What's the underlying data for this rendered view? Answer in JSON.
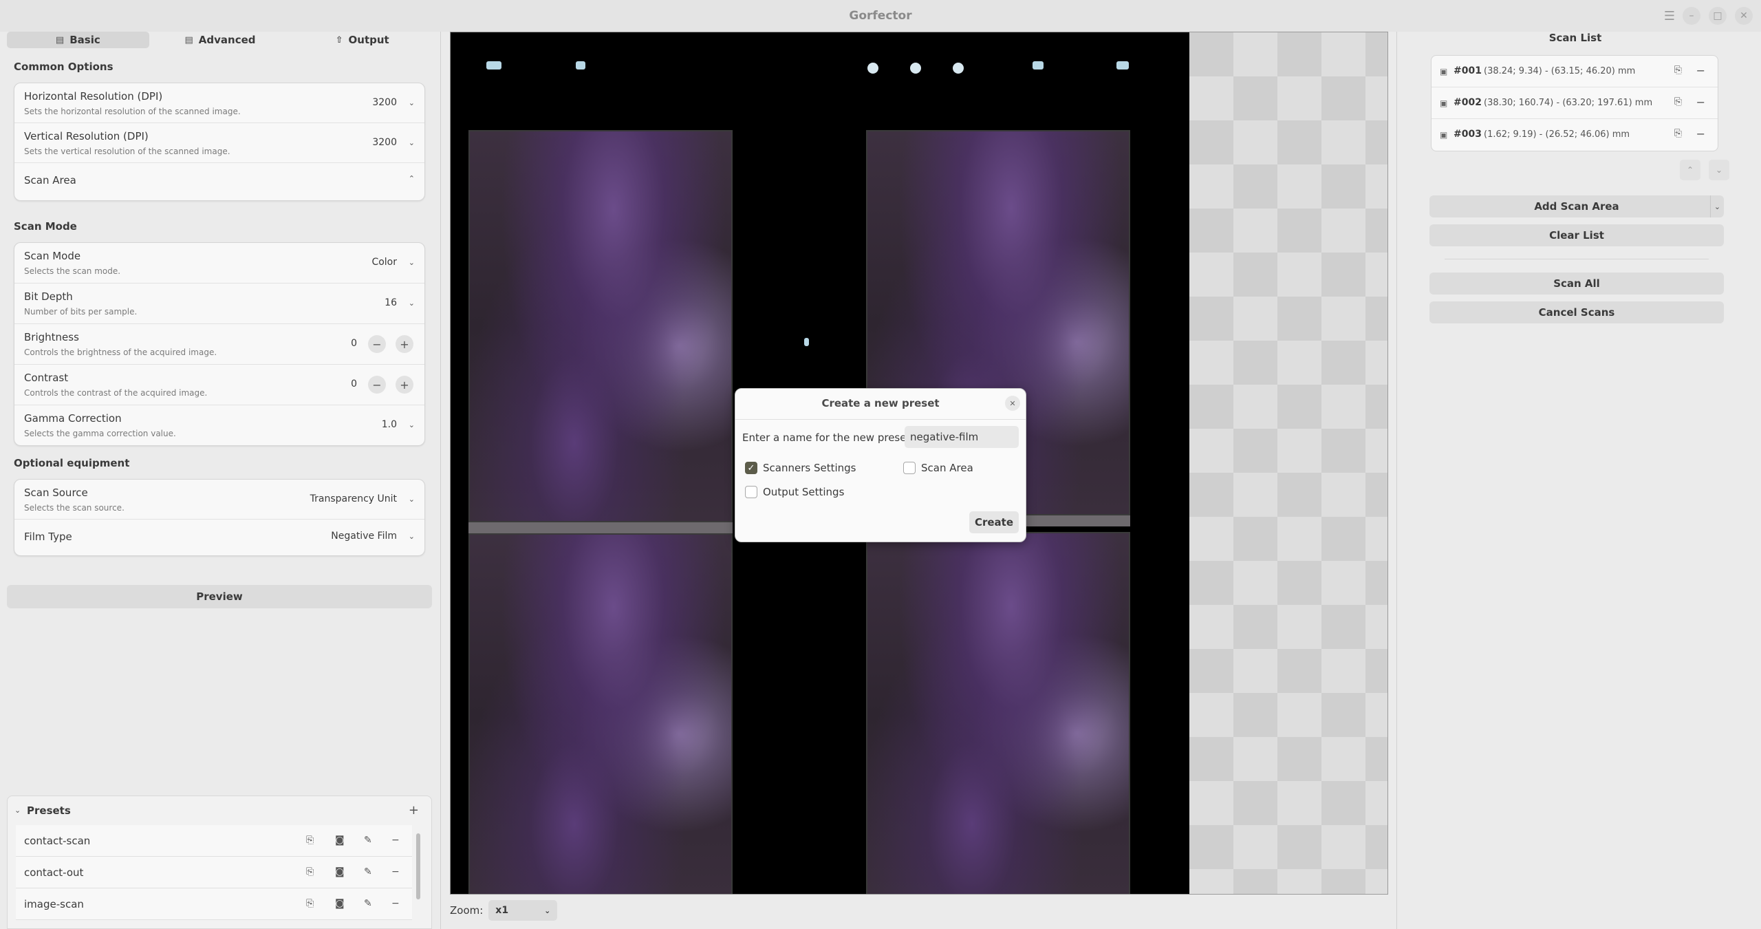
{
  "window": {
    "title": "Gorfector",
    "controls": [
      "menu-icon",
      "minimize-icon",
      "maximize-icon",
      "close-icon"
    ]
  },
  "tabs": [
    {
      "label": "Basic",
      "icon": "document-icon",
      "active": true
    },
    {
      "label": "Advanced",
      "icon": "document-icon",
      "active": false
    },
    {
      "label": "Output",
      "icon": "upload-icon",
      "active": false
    }
  ],
  "common_options": {
    "title": "Common Options",
    "rows": [
      {
        "label": "Horizontal Resolution (DPI)",
        "subtitle": "Sets the horizontal resolution of the scanned image.",
        "value": "3200"
      },
      {
        "label": "Vertical Resolution (DPI)",
        "subtitle": "Sets the vertical resolution of the scanned image.",
        "value": "3200"
      },
      {
        "label": "Scan Area"
      }
    ]
  },
  "scan_mode": {
    "title": "Scan Mode",
    "rows": [
      {
        "label": "Scan Mode",
        "subtitle": "Selects the scan mode.",
        "value": "Color"
      },
      {
        "label": "Bit Depth",
        "subtitle": "Number of bits per sample.",
        "value": "16"
      },
      {
        "label": "Brightness",
        "subtitle": "Controls the brightness of the acquired image.",
        "value": "0"
      },
      {
        "label": "Contrast",
        "subtitle": "Controls the contrast of the acquired image.",
        "value": "0"
      },
      {
        "label": "Gamma Correction",
        "subtitle": "Selects the gamma correction value.",
        "value": "1.0"
      }
    ]
  },
  "optional_equipment": {
    "title": "Optional equipment",
    "rows": [
      {
        "label": "Scan Source",
        "subtitle": "Selects the scan source.",
        "value": "Transparency Unit"
      },
      {
        "label": "Film Type",
        "value": "Negative Film"
      }
    ]
  },
  "preview_button": "Preview",
  "presets": {
    "title": "Presets",
    "items": [
      "contact-scan",
      "contact-out",
      "image-scan"
    ]
  },
  "zoom": {
    "label": "Zoom:",
    "value": "x1"
  },
  "scan_list": {
    "title": "Scan List",
    "items": [
      {
        "id": "#001",
        "coords": "(38.24; 9.34) - (63.15; 46.20) mm"
      },
      {
        "id": "#002",
        "coords": "(38.30; 160.74) - (63.20; 197.61) mm"
      },
      {
        "id": "#003",
        "coords": "(1.62; 9.19) - (26.52; 46.06) mm"
      }
    ],
    "add_scan_area": "Add Scan Area",
    "clear_list": "Clear List",
    "scan_all": "Scan All",
    "cancel_scans": "Cancel Scans"
  },
  "dialog": {
    "title": "Create a new preset",
    "name_label": "Enter a name for the new preset:",
    "name_value": "negative-film",
    "options": [
      {
        "label": "Scanners Settings",
        "checked": true
      },
      {
        "label": "Scan Area",
        "checked": false
      },
      {
        "label": "Output Settings",
        "checked": false
      }
    ],
    "create_button": "Create"
  },
  "colors": {
    "checkbox_checked": "#5c5c4a",
    "preview_background": "#000000"
  }
}
